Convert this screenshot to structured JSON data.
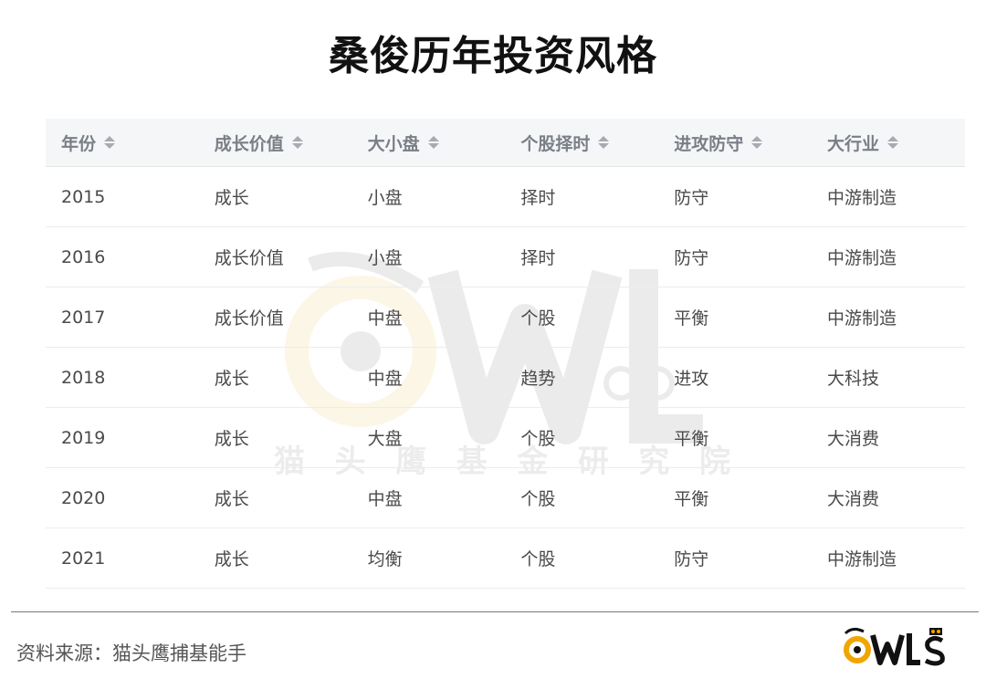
{
  "title": "桑俊历年投资风格",
  "table": {
    "headers": [
      "年份",
      "成长价值",
      "大小盘",
      "个股择时",
      "进攻防守",
      "大行业"
    ],
    "rows": [
      [
        "2015",
        "成长",
        "小盘",
        "择时",
        "防守",
        "中游制造"
      ],
      [
        "2016",
        "成长价值",
        "小盘",
        "择时",
        "防守",
        "中游制造"
      ],
      [
        "2017",
        "成长价值",
        "中盘",
        "个股",
        "平衡",
        "中游制造"
      ],
      [
        "2018",
        "成长",
        "中盘",
        "趋势",
        "进攻",
        "大科技"
      ],
      [
        "2019",
        "成长",
        "大盘",
        "个股",
        "平衡",
        "大消费"
      ],
      [
        "2020",
        "成长",
        "中盘",
        "个股",
        "平衡",
        "大消费"
      ],
      [
        "2021",
        "成长",
        "均衡",
        "个股",
        "防守",
        "中游制造"
      ]
    ]
  },
  "watermark": {
    "text_chars": [
      "猫",
      "头",
      "鹰",
      "基",
      "金",
      "研",
      "究",
      "院"
    ]
  },
  "footer": {
    "source": "资料来源：猫头鹰捕基能手"
  },
  "icons": {
    "sort": "sort-icon",
    "logo": "owls-logo-icon"
  },
  "colors": {
    "header_bg": "#f5f6f8",
    "logo_accent": "#f0a500"
  }
}
